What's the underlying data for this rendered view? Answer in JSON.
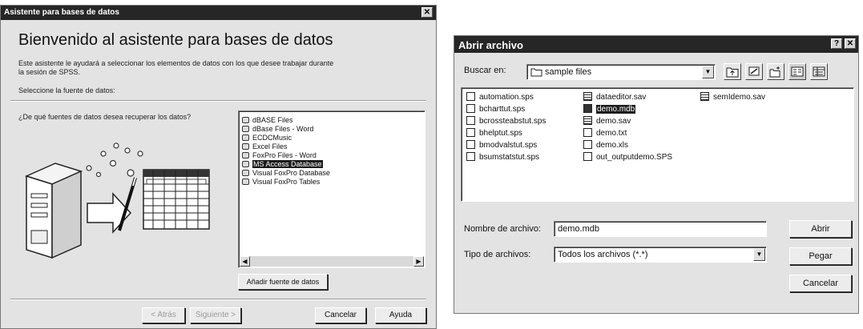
{
  "wizard": {
    "title": "Asistente para bases de datos",
    "close_glyph": "✕",
    "heading": "Bienvenido al asistente para bases de datos",
    "intro": "Este asistente le ayudará a seleccionar los elementos de datos con los que desee trabajar durante la sesión de SPSS.",
    "select_source": "Seleccione la fuente de datos:",
    "question": "¿De qué fuentes de datos desea recuperar los datos?",
    "sources": [
      {
        "label": "dBASE Files",
        "icon": "odbc-source-icon"
      },
      {
        "label": "dBase Files - Word",
        "icon": "odbc-source-icon"
      },
      {
        "label": "ECDCMusic",
        "icon": "odbc-source-icon"
      },
      {
        "label": "Excel Files",
        "icon": "odbc-source-icon"
      },
      {
        "label": "FoxPro Files - Word",
        "icon": "odbc-source-icon"
      },
      {
        "label": "MS Access Database",
        "icon": "odbc-source-icon",
        "selected": true
      },
      {
        "label": "Visual FoxPro Database",
        "icon": "odbc-source-icon"
      },
      {
        "label": "Visual FoxPro Tables",
        "icon": "odbc-source-icon"
      }
    ],
    "add_source": "Añadir fuente de datos",
    "back": "< Atrás",
    "next": "Siguiente >",
    "cancel": "Cancelar",
    "help": "Ayuda"
  },
  "file_dialog": {
    "title": "Abrir archivo",
    "help_glyph": "?",
    "close_glyph": "✕",
    "look_in_label": "Buscar en:",
    "look_in_value": "sample files",
    "files": [
      {
        "name": "automation.sps",
        "icon": "syntax-file-icon"
      },
      {
        "name": "bcharttut.sps",
        "icon": "syntax-file-icon"
      },
      {
        "name": "bcrossteabstut.sps",
        "icon": "syntax-file-icon"
      },
      {
        "name": "bhelptut.sps",
        "icon": "syntax-file-icon"
      },
      {
        "name": "bmodvalstut.sps",
        "icon": "syntax-file-icon"
      },
      {
        "name": "bsumstatstut.sps",
        "icon": "syntax-file-icon"
      },
      {
        "name": "dataeditor.sav",
        "icon": "data-file-icon"
      },
      {
        "name": "demo.mdb",
        "icon": "access-file-icon",
        "selected": true
      },
      {
        "name": "demo.sav",
        "icon": "data-file-icon"
      },
      {
        "name": "demo.txt",
        "icon": "text-file-icon"
      },
      {
        "name": "demo.xls",
        "icon": "excel-file-icon"
      },
      {
        "name": "out_outputdemo.SPS",
        "icon": "syntax-file-icon"
      },
      {
        "name": "semIdemo.sav",
        "icon": "data-file-icon"
      }
    ],
    "filename_label": "Nombre de archivo:",
    "filename_value": "demo.mdb",
    "filetype_label": "Tipo de archivos:",
    "filetype_value": "Todos los archivos (*.*)",
    "open": "Abrir",
    "paste": "Pegar",
    "cancel": "Cancelar"
  }
}
